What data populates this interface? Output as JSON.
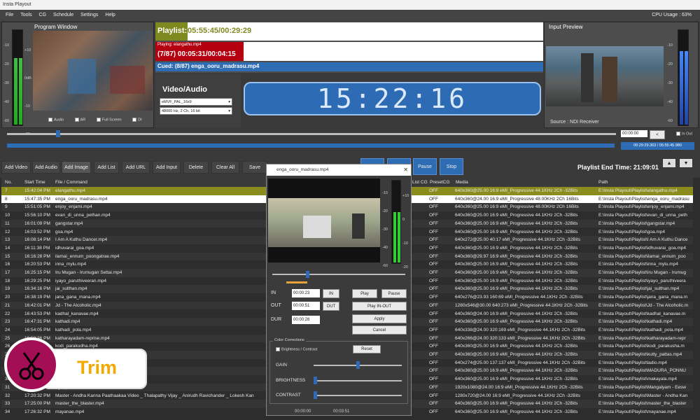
{
  "app_title": "Insta Playout",
  "menu": [
    "File",
    "Tools",
    "CG",
    "Schedule",
    "Settings",
    "Help"
  ],
  "cpu_usage": "CPU Usage : 63%",
  "program_window": {
    "title": "Program Window",
    "checks": [
      "Audio",
      "AR",
      "Full Screen",
      "DI"
    ],
    "scale_left": [
      "-10",
      "-20",
      "-30",
      "-40",
      "-60"
    ],
    "scale_right": [
      "+10",
      "0dB",
      "-10",
      "-20"
    ]
  },
  "playlist_panel": {
    "label": "Playlist:",
    "time": "05:55:45/00:29:29",
    "playing_label": "Playing: elangathu.mp4",
    "playing_time": "(7/87) 00:05:31/00:04:15",
    "cued": "Cued: (8/87) enga_ooru_madrasu.mp4"
  },
  "video_audio": {
    "title": "Video/Audio",
    "video_format": "eMVF_PAL_16x9",
    "audio_format": "48000 Hz, 2 Ch, 16 bit"
  },
  "clock": "15:22:16",
  "input_preview": {
    "title": "Input Preview",
    "source": "Source : NDI Receiver"
  },
  "seek": {
    "time_box": "00:00:00",
    "mute_label": "In Out",
    "progress_time": "00:29:29.363 / 05:55:45.980"
  },
  "toolbar": {
    "buttons": [
      "Add Video",
      "Add Audio",
      "Add Image",
      "Add List",
      "Add URL",
      "Add Input",
      "Delete",
      "Clear All",
      "Save"
    ],
    "pause": "Pause",
    "stop": "Stop",
    "end_time": "Playlist End Time: 21:09:01"
  },
  "table": {
    "headers": [
      "No.",
      "Start Time",
      "File / Command",
      "PresetCG",
      "Media",
      "Path"
    ],
    "list_cg_header": "List CG",
    "rows": [
      [
        "7",
        "15:42:04 PM",
        "elangathu.mp4",
        "OFF",
        "640x360@25.00 16:9 eMI_Progressive 44.1KHz 2Ch -32Bits",
        "E:\\Insta Playout\\Playlist\\elangathu.mp4"
      ],
      [
        "8",
        "15:47:35 PM",
        "enga_ooru_madrasu.mp4",
        "OFF",
        "640x360@24.00 16:9 eMI_Progressive 48.00KHz 2Ch 16Bits",
        "E:\\Insta Playout\\Playlist\\enga_ooru_madrasu"
      ],
      [
        "9",
        "15:51:05 PM",
        "enjoy_enjami.mp4",
        "OFF",
        "640x360@25.00 16:9 eMI_Progressive 48.00KHz 2Ch 16Bits",
        "E:\\Insta Playout\\Playlist\\enjoy_enjami.mp4"
      ],
      [
        "10",
        "15:56:10 PM",
        "evan_di_unna_pethan.mp4",
        "OFF",
        "640x360@25.00 16:9 eMI_Progressive 44.1KHz 2Ch -32Bits",
        "E:\\Insta Playout\\Playlist\\evan_di_unna_peth"
      ],
      [
        "11",
        "16:01:09 PM",
        "gangstar.mp4",
        "OFF",
        "640x360@25.00 16:9 eMI_Progressive 44.1KHz 2Ch -32Bits",
        "E:\\Insta Playout\\Playlist\\gangstar.mp4"
      ],
      [
        "12",
        "16:03:52 PM",
        "goa.mp4",
        "OFF",
        "640x360@25.00 16:9 eMI_Progressive 44.1KHz 2Ch -32Bits",
        "E:\\Insta Playout\\Playlist\\goa.mp4"
      ],
      [
        "13",
        "16:08:14 PM",
        "I Am A Kuthu Dancer.mp4",
        "OFF",
        "640x272@25.00 40:17 eMI_Progressive 44.1KHz 2Ch -32Bits",
        "E:\\Insta Playout\\Playlist\\I Am A Kuthu Dance"
      ],
      [
        "14",
        "16:11:38 PM",
        "idhuvarai_goa.mp4",
        "OFF",
        "640x360@25.00 16:9 eMI_Progressive 44.1KHz 2Ch -32Bits",
        "E:\\Insta Playout\\Playlist\\idhuvarai_goa.mp4"
      ],
      [
        "15",
        "16:16:28 PM",
        "ilamai_ennum_poongatrae.mp4",
        "OFF",
        "640x360@29.97 16:9 eMI_Progressive 44.1KHz 2Ch -32Bits",
        "E:\\Insta Playout\\Playlist\\ilamai_ennum_poo"
      ],
      [
        "16",
        "16:20:53 PM",
        "inna_mylu.mp4",
        "OFF",
        "640x360@25.00 16:9 eMI_Progressive 44.1KHz 2Ch -32Bits",
        "E:\\Insta Playout\\Playlist\\inna_mylu.mp4"
      ],
      [
        "17",
        "16:25:15 PM",
        "Iru Mugan - Irumugan Settai.mp4",
        "OFF",
        "640x360@25.00 16:9 eMI_Progressive 44.1KHz 2Ch -32Bits",
        "E:\\Insta Playout\\Playlist\\Iru Mugan - Irumug"
      ],
      [
        "18",
        "16:29:25 PM",
        "iyayo_paruthiveeran.mp4",
        "OFF",
        "640x360@25.00 16:9 eMI_Progressive 44.1KHz 2Ch -32Bits",
        "E:\\Insta Playout\\Playlist\\iyayo_paruthiveera"
      ],
      [
        "19",
        "16:34:16 PM",
        "jai_sulthan.mp4",
        "OFF",
        "640x360@25.00 16:9 eMI_Progressive 44.1KHz 2Ch -32Bits",
        "E:\\Insta Playout\\Playlist\\jai_sulthan.mp4"
      ],
      [
        "20",
        "16:38:19 PM",
        "jana_gana_mana.mp4",
        "OFF",
        "640x276@23.93 160:69 eMI_Progressive 44.1KHz 2Ch -32Bits",
        "E:\\Insta Playout\\Playlist\\jana_gana_mana.m"
      ],
      [
        "21",
        "16:42:01 PM",
        "Jd - The Alcoholic.mp4",
        "OFF",
        "1280x546@30.00 640:273 eMI_Progressive 44.1KHz 2Ch -32Bits",
        "E:\\Insta Playout\\Playlist\\Jd - The Alcoholic.m"
      ],
      [
        "22",
        "16:43:53 PM",
        "kadhal_kanavae.mp4",
        "OFF",
        "640x360@24.00 16:9 eMI_Progressive 44.1KHz 2Ch -32Bits",
        "E:\\Insta Playout\\Playlist\\kadhal_kanavae.m"
      ],
      [
        "23",
        "16:47:31 PM",
        "kathadi.mp4",
        "OFF",
        "640x360@25.00 16:9 eMI_Progressive 44.1KHz 2Ch -32Bits",
        "E:\\Insta Playout\\Playlist\\kathadi.mp4"
      ],
      [
        "24",
        "16:54:05 PM",
        "kathadi_pola.mp4",
        "OFF",
        "640x338@24.00 320:169 eMI_Progressive 44.1KHz 2Ch -32Bits",
        "E:\\Insta Playout\\Playlist\\kathadi_pola.mp4"
      ],
      [
        "25",
        "16:58:36 PM",
        "katharayadam-reprise.mp4",
        "OFF",
        "640x266@24.00 320:133 eMI_Progressive 44.1KHz 2Ch -32Bits",
        "E:\\Insta Playout\\Playlist\\katharayadam-repr"
      ],
      [
        "26",
        "",
        "kodi_parakudha.mp4",
        "OFF",
        "640x360@25.00 16:9 eMI_Progressive 44.1KHz 2Ch -32Bits",
        "E:\\Insta Playout\\Playlist\\kodi_parakusha.m"
      ],
      [
        "27",
        "",
        "",
        "OFF",
        "640x360@25.00 16:9 eMI_Progressive 44.1KHz 2Ch -32Bits",
        "E:\\Insta Playout\\Playlist\\kutty_pattas.mp4"
      ],
      [
        "28",
        "",
        "",
        "OFF",
        "640x274@25.00 137:137 eMI_Progressive 44.1KHz 2Ch -32Bits",
        "E:\\Insta Playout\\Playlist\\ladio.mp4"
      ],
      [
        "29",
        "",
        "",
        "OFF",
        "640x360@25.00 16:9 eMI_Progressive 44.1KHz 2Ch -32Bits",
        "E:\\Insta Playout\\Playlist\\MADURA_PONNU"
      ],
      [
        "30",
        "",
        "",
        "OFF",
        "640x360@25.00 16:9 eMI_Progressive 44.1KHz 2Ch -32Bits",
        "E:\\Insta Playout\\Playlist\\makayala.mp4"
      ],
      [
        "31",
        "",
        "ng.mp4",
        "OFF",
        "1920x1080@24.00 16:9 eMI_Progressive 44.1KHz 2Ch -32Bits",
        "E:\\Insta Playout\\Playlist\\Mangalyam - Eesw"
      ],
      [
        "32",
        "17:20:32 PM",
        "Master - Andha Kanna Paathaakaa Video _ Thalapathy Vijay _ Anirudh Ravichander _ Lokesh Kan",
        "OFF",
        "1280x720@24.00 16:9 eMI_Progressive 44.1KHz 2Ch -32Bits",
        "E:\\Insta Playout\\Playlist\\Master - Andha Kan"
      ],
      [
        "33",
        "17:25:00 PM",
        "master_the_blaster.mp4",
        "OFF",
        "640x360@25.00 16:9 eMI_Progressive 44.1KHz 2Ch -32Bits",
        "E:\\Insta Playout\\Playlist\\master_the_blaster"
      ],
      [
        "34",
        "17:26:32 PM",
        "mayanae.mp4",
        "OFF",
        "640x360@25.00 16:9 eMI_Progressive 44.1KHz 2Ch -32Bits",
        "E:\\Insta Playout\\Playlist\\mayanae.mp4"
      ]
    ]
  },
  "dialog": {
    "title": "enga_ooru_madrasu.mp4",
    "close": "✕",
    "in_label": "IN",
    "in_value": "00:00:23",
    "in_btn": "IN",
    "out_label": "OUT",
    "out_value": "00:00:51",
    "out_btn": "OUT",
    "dur_label": "DUR",
    "dur_value": "00:00:28",
    "play": "Play",
    "pause": "Pause",
    "play_in_out": "Play IN-OUT",
    "apply": "Apply",
    "cancel": "Cancel",
    "color_corrections": "Color Corrections",
    "brightness_contrast": "Brightness / Contrast",
    "reset": "Reset",
    "gain": "GAIN",
    "brightness": "BRIGHTNESS",
    "contrast": "CONTRAST",
    "scale_left": [
      "-10",
      "-20",
      "-30",
      "-40",
      "-60"
    ],
    "scale_right": [
      "+10",
      "0",
      "-10",
      "-20"
    ],
    "row_times": [
      "00:00:00",
      "00:03:51"
    ]
  },
  "trim_badge": {
    "label": "Trim"
  }
}
